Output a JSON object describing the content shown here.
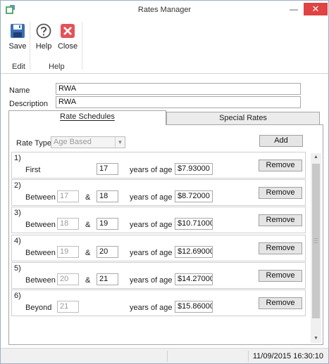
{
  "window": {
    "title": "Rates Manager"
  },
  "ribbon": {
    "save_label": "Save",
    "help_label": "Help",
    "close_label": "Close",
    "groups": {
      "edit": "Edit",
      "help": "Help"
    }
  },
  "form": {
    "name_label": "Name",
    "name_value": "RWA",
    "description_label": "Description",
    "description_value": "RWA"
  },
  "tabs": {
    "rate_schedules": "Rate Schedules",
    "special_rates": "Special Rates"
  },
  "rate_type": {
    "label": "Rate Type",
    "selected": "Age Based"
  },
  "add_label": "Add",
  "rows": [
    {
      "num": "1)",
      "kind": "First",
      "to": "17",
      "years_label": "years of age",
      "rate": "$7.93000",
      "remove": "Remove"
    },
    {
      "num": "2)",
      "kind": "Between",
      "from": "17",
      "amp": "&",
      "to": "18",
      "years_label": "years of age",
      "rate": "$8.72000",
      "remove": "Remove"
    },
    {
      "num": "3)",
      "kind": "Between",
      "from": "18",
      "amp": "&",
      "to": "19",
      "years_label": "years of age",
      "rate": "$10.71000",
      "remove": "Remove"
    },
    {
      "num": "4)",
      "kind": "Between",
      "from": "19",
      "amp": "&",
      "to": "20",
      "years_label": "years of age",
      "rate": "$12.69000",
      "remove": "Remove"
    },
    {
      "num": "5)",
      "kind": "Between",
      "from": "20",
      "amp": "&",
      "to": "21",
      "years_label": "years of age",
      "rate": "$14.27000",
      "remove": "Remove"
    },
    {
      "num": "6)",
      "kind": "Beyond",
      "from": "21",
      "years_label": "years of age",
      "rate": "$15.86000",
      "remove": "Remove"
    }
  ],
  "status": {
    "datetime": "11/09/2015 16:30:10"
  },
  "icons": {
    "app": "app-icon",
    "minimize": "minimize-icon",
    "close_window": "close-window-icon",
    "save": "save-icon",
    "help": "help-icon",
    "close": "close-icon"
  },
  "colors": {
    "close_button": "#e04343",
    "save_icon": "#3b6fb6",
    "close_icon": "#e2535a"
  }
}
